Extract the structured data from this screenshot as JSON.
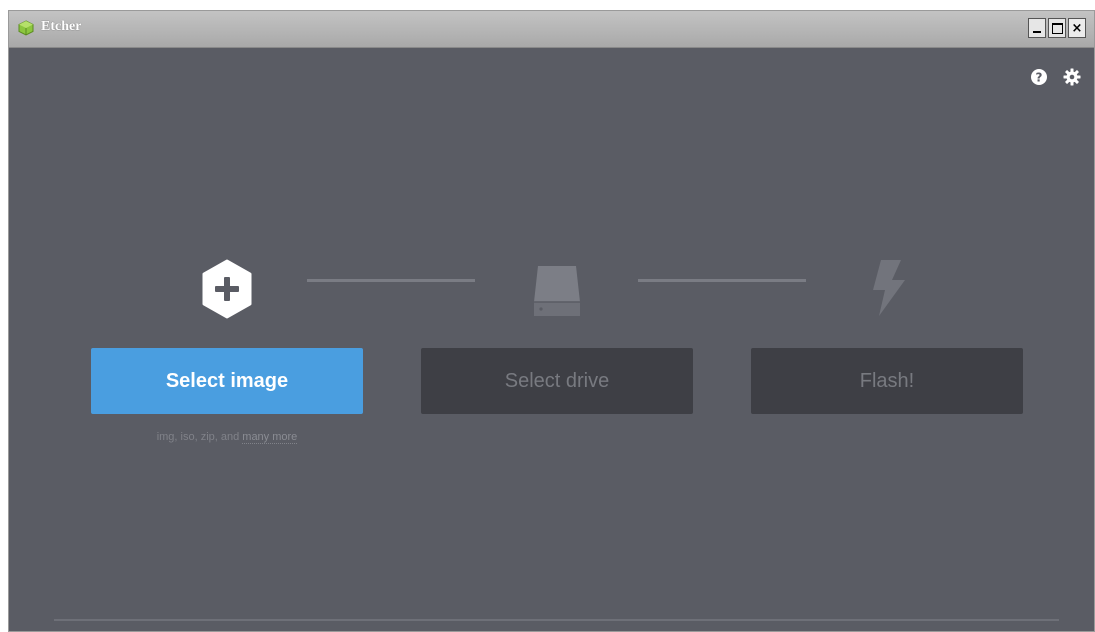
{
  "window": {
    "title": "Etcher",
    "controls": {
      "minimize": "minimize-icon",
      "maximize": "maximize-icon",
      "close": "×"
    }
  },
  "header_icons": [
    "help-icon",
    "gear-icon"
  ],
  "steps": [
    {
      "icon": "plus-hexagon-icon",
      "button_label": "Select image",
      "active": true
    },
    {
      "icon": "drive-icon",
      "button_label": "Select drive",
      "active": false
    },
    {
      "icon": "lightning-bolt-icon",
      "button_label": "Flash!",
      "active": false
    }
  ],
  "image_hint": {
    "text": "img, iso, zip, and ",
    "link": "many more"
  },
  "colors": {
    "background": "#5a5c64",
    "accent": "#4a9ee0",
    "disabled_button": "#3e3f45",
    "disabled_text": "#787a80"
  }
}
